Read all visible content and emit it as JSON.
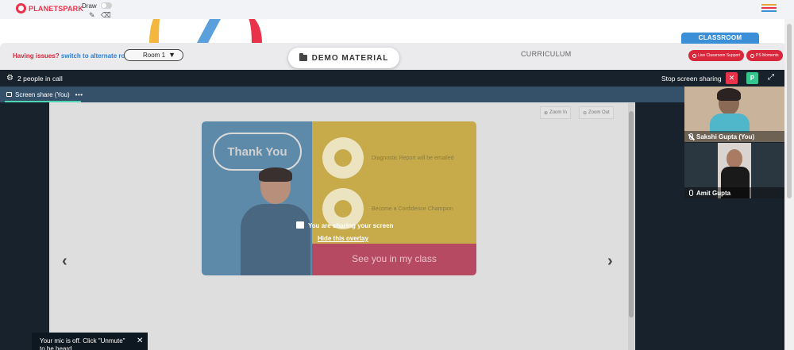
{
  "header": {
    "logo_text": "PLANETSPARK",
    "draw_label": "Draw",
    "pen_icon": "pencil-icon",
    "eraser_icon": "eraser-icon",
    "menu_icon": "hamburger-menu-icon"
  },
  "strip": {
    "issues_text": "Having issues?",
    "alternate_link": "switch to alternate room",
    "room_value": "Room 1",
    "demo_material": "DEMO MATERIAL",
    "curriculum": "CURRICULUM",
    "classroom_tab": "CLASSROOM",
    "live_support": "Live Classroom Support",
    "ps_moments": "PS Moments"
  },
  "callbar": {
    "people_count": "2 people in call",
    "stop_sharing": "Stop screen sharing",
    "stop_x": "✕",
    "p_label": "P"
  },
  "tabs": [
    {
      "label": "Screen share (You)",
      "more": "•••"
    }
  ],
  "stage": {
    "zoom_in": "Zoom In",
    "zoom_out": "Zoom Out",
    "slide_thank_you": "Thank You",
    "feature_1": "Diagnostic Report will be emailed",
    "feature_2": "Become a Confidence Champion",
    "slide_see_you": "See you in my class",
    "overlay_text": "You are sharing your screen",
    "hide_overlay": "Hide this overlay",
    "prev_arrow": "‹",
    "next_arrow": "›"
  },
  "participants": [
    {
      "name": "Sakshi Gupta (You)",
      "mic": "mic-off"
    },
    {
      "name": "Amit Gupta",
      "mic": "mic-on"
    }
  ],
  "toast": {
    "message": "Your mic is off. Click \"Unmute\" to be heard",
    "close": "✕"
  },
  "colors": {
    "brand_red": "#e8334a",
    "link_blue": "#2a7fd4",
    "call_bg": "#17222c",
    "tab_bg": "#35516a",
    "accent_green": "#37c58e"
  }
}
